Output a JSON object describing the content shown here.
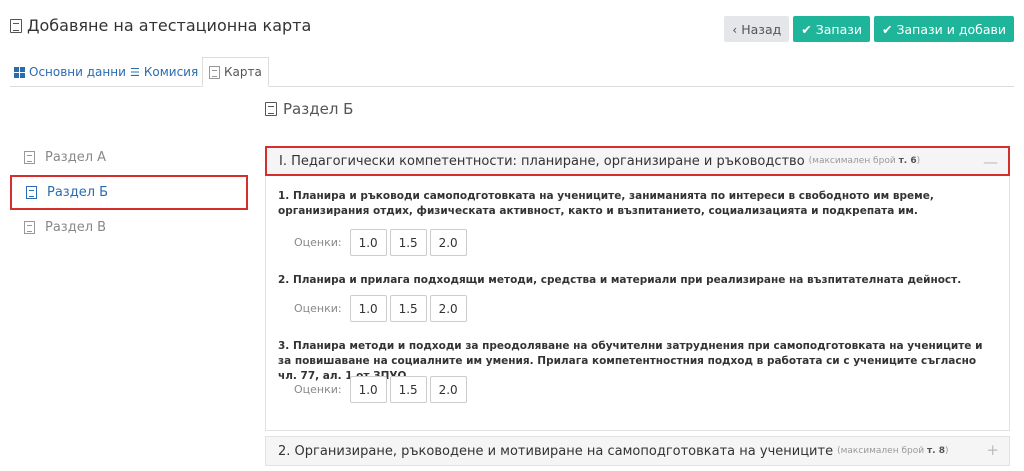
{
  "page": {
    "title": "Добавяне на атестационна карта"
  },
  "toolbar": {
    "back_label": "Назад",
    "save_label": "Запази",
    "save_add_label": "Запази и добави"
  },
  "tabs": [
    {
      "label": "Основни данни",
      "icon": "grid-icon"
    },
    {
      "label": "Комисия",
      "icon": "list-icon"
    },
    {
      "label": "Карта",
      "icon": "doc-icon",
      "active": true
    }
  ],
  "section": {
    "title": "Раздел Б"
  },
  "sidebar": {
    "items": [
      {
        "label": "Раздел А"
      },
      {
        "label": "Раздел Б",
        "active": true
      },
      {
        "label": "Раздел В"
      }
    ]
  },
  "panel1": {
    "title": "I. Педагогически компетентности: планиране, организиране и ръководство",
    "max_label": "(максимален брой",
    "max_value": "т. 6",
    "max_close": ")",
    "grades_label": "Оценки:",
    "questions": [
      {
        "text": "1. Планира и ръководи самоподготовката на учениците, заниманията по интереси в свободното им време, организирания отдих, физическата активност, както и възпитанието, социализацията и подкрепата им.",
        "grades": [
          "1.0",
          "1.5",
          "2.0"
        ]
      },
      {
        "text": "2. Планира и прилага подходящи методи, средства и материали при реализиране на възпитателната дейност.",
        "grades": [
          "1.0",
          "1.5",
          "2.0"
        ]
      },
      {
        "text": "3. Планира методи и подходи за преодоляване на обучителни затруднения при самоподготовката на учениците и за повишаване на социалните им умения. Прилага компетентностния подход в работата си с учениците съгласно чл. 77, ал. 1 от ЗПУО.",
        "grades": [
          "1.0",
          "1.5",
          "2.0"
        ]
      }
    ]
  },
  "panel2": {
    "title": "2. Организиране, ръководене и мотивиране на самоподготовката на учениците",
    "max_label": "(максимален брой",
    "max_value": "т. 8",
    "max_close": ")"
  }
}
